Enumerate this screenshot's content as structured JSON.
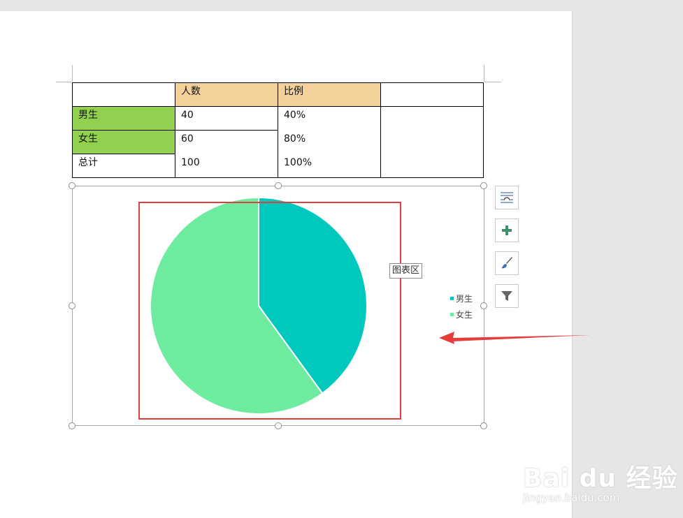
{
  "table": {
    "header": [
      "",
      "人数",
      "比例",
      ""
    ],
    "rows": [
      {
        "label": "男生",
        "count": "40",
        "ratio": "40%"
      },
      {
        "label": "女生",
        "count": "60",
        "ratio": "80%"
      },
      {
        "label": "总计",
        "count": "100",
        "ratio": "100%"
      }
    ]
  },
  "chart_data": {
    "type": "pie",
    "categories": [
      "男生",
      "女生"
    ],
    "values": [
      40,
      60
    ],
    "colors": [
      "#00c8bd",
      "#6deb9f"
    ],
    "legend_position": "right"
  },
  "tooltip": "图表区",
  "side_buttons": [
    {
      "icon": "layout-options-icon"
    },
    {
      "icon": "plus-icon"
    },
    {
      "icon": "brush-icon"
    },
    {
      "icon": "filter-icon"
    }
  ],
  "watermark": {
    "main": "Bai du 经验",
    "sub": "jingyan.baidu.com"
  },
  "colors": {
    "highlight": "#e53c3c",
    "arrow": "#e53c3c",
    "header": "#f4d09a",
    "label": "#92d14f"
  }
}
